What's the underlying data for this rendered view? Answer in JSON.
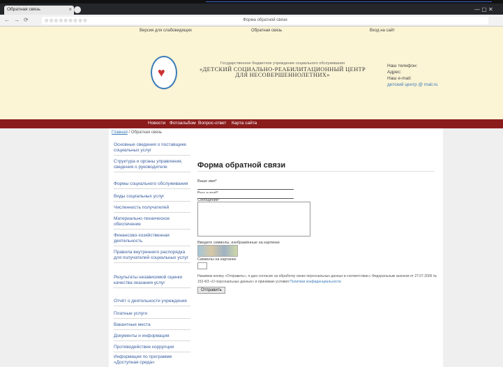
{
  "browser": {
    "tab_title": "Обратная связь",
    "tab_close": "×",
    "url": "◎ ◎ ◎ ◎ ◎ ◎ ◎ ◎ ◎",
    "center_title": "Форма обратной связи",
    "win_controls": "— ▢ ✕"
  },
  "header": {
    "top_links": [
      {
        "label": "Версия для слабовидящих"
      },
      {
        "label": "Обратная связь"
      },
      {
        "label": "Вход на сайт"
      }
    ],
    "org_line1": "Государственное бюджетное учреждение социального обслуживания",
    "org_line2": "«ДЕТСКИЙ СОЦИАЛЬНО-РЕАБИЛИТАЦИОННЫЙ ЦЕНТР",
    "org_line3": "ДЛЯ НЕСОВЕРШЕННОЛЕТНИХ»",
    "contact_line1": "Наш телефон:",
    "contact_line2": "Адрес:",
    "contact_line3": "Наш e-mail:",
    "contact_email": "детский центр @ mail.ru"
  },
  "nav": [
    {
      "label": "Новости"
    },
    {
      "label": "Фотоальбом"
    },
    {
      "label": "Вопрос-ответ"
    },
    {
      "label": "Карта сайта"
    }
  ],
  "breadcrumb": {
    "link": "Главная",
    "current": "/ Обратная связь"
  },
  "sidebar": [
    {
      "label": "Основные сведения о поставщике социальных услуг"
    },
    {
      "label": "Структура и органы управления, сведения о руководителе"
    },
    {
      "label": "Формы социального обслуживания"
    },
    {
      "label": "Виды социальных услуг"
    },
    {
      "label": "Численность получателей"
    },
    {
      "label": "Материально-техническое обеспечение"
    },
    {
      "label": "Финансово-хозяйственная деятельность"
    },
    {
      "label": "Правила внутреннего распорядка для получателей социальных услуг"
    },
    {
      "label": "Результаты независимой оценки качества оказания услуг"
    },
    {
      "label": "Отчёт о деятельности учреждения"
    },
    {
      "label": "Платные услуги"
    },
    {
      "label": "Вакантные места"
    },
    {
      "label": "Документы и информация"
    },
    {
      "label": "Противодействие коррупции"
    },
    {
      "label": "Информация по программе «Доступная среда»"
    }
  ],
  "form": {
    "title": "Форма обратной связи",
    "name_label": "Ваше имя*",
    "email_label": "Ваш e-mail*",
    "comment_label": "Сообщение*",
    "captcha_label": "Введите символы, изображённые на картинке",
    "captcha_hint": "Символы на картинке",
    "consent_text": "Нажимая кнопку «Отправить», я даю согласие на обработку своих персональных данных в соответствии с Федеральным законом от 27.07.2006 № 152-ФЗ «О персональных данных» и принимаю условия",
    "consent_link": "Политики конфиденциальности",
    "submit_label": "Отправить"
  }
}
